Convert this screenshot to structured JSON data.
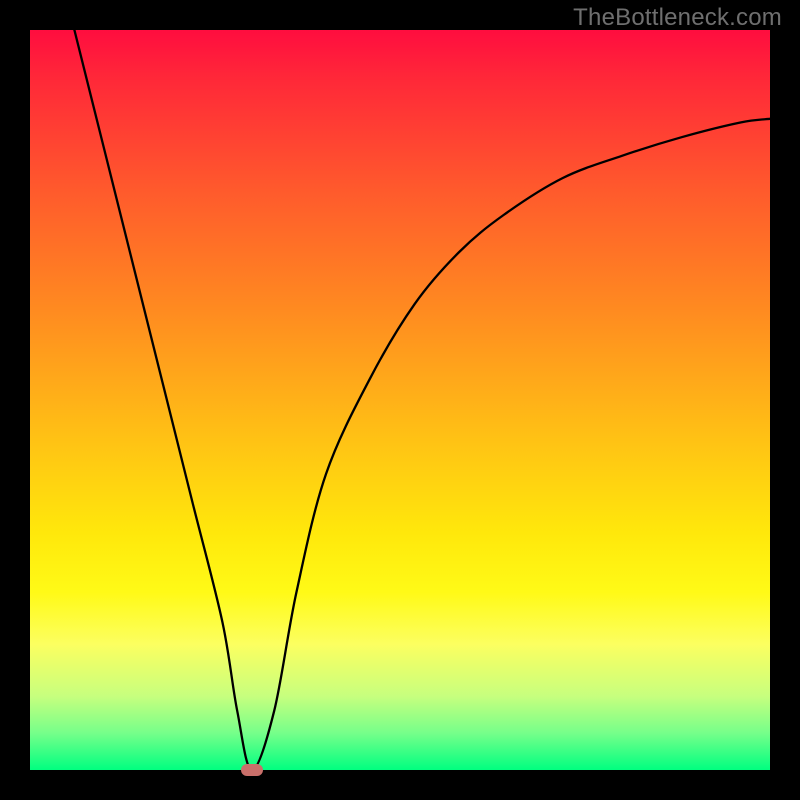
{
  "watermark": "TheBottleneck.com",
  "chart_data": {
    "type": "line",
    "title": "",
    "xlabel": "",
    "ylabel": "",
    "xlim": [
      0,
      100
    ],
    "ylim": [
      0,
      100
    ],
    "grid": false,
    "legend": false,
    "background_gradient": {
      "top": "#ff0d3f",
      "bottom": "#00ff80",
      "meaning": "red=high bottleneck, green=low bottleneck"
    },
    "series": [
      {
        "name": "bottleneck-curve",
        "x": [
          6,
          10,
          14,
          18,
          22,
          26,
          28,
          30,
          33,
          36,
          40,
          46,
          52,
          58,
          64,
          72,
          80,
          88,
          96,
          100
        ],
        "y": [
          100,
          84,
          68,
          52,
          36,
          20,
          8,
          0,
          8,
          24,
          40,
          53,
          63,
          70,
          75,
          80,
          83,
          85.5,
          87.5,
          88
        ],
        "color": "#000000"
      }
    ],
    "marker": {
      "name": "optimal-point",
      "x": 30,
      "y": 0,
      "color": "#c96f6a"
    }
  }
}
